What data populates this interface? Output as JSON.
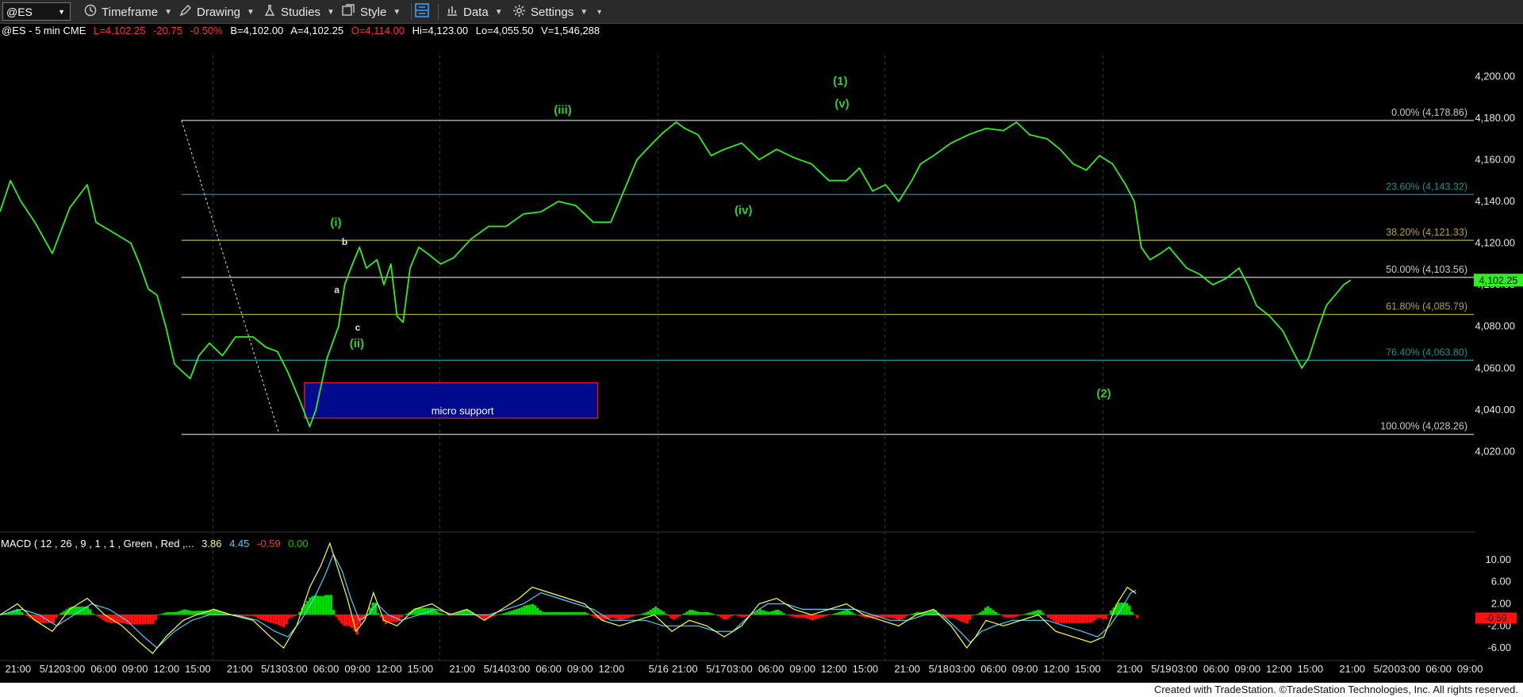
{
  "toolbar": {
    "symbol": "@ES",
    "timeframe": "Timeframe",
    "drawing": "Drawing",
    "studies": "Studies",
    "style": "Style",
    "data": "Data",
    "settings": "Settings"
  },
  "header": {
    "symbol_info": "@ES - 5 min  CME",
    "last": "L=4,102.25",
    "change": "-20.75",
    "pct": "-0.50%",
    "bid": "B=4,102.00",
    "ask": "A=4,102.25",
    "open": "O=4,114.00",
    "high": "Hi=4,123.00",
    "low": "Lo=4,055.50",
    "volume": "V=1,546,288"
  },
  "colors": {
    "price": "#33ee22",
    "up": "#00dd00",
    "down": "#ff1111",
    "macd": "#ffff55",
    "signal": "#4fd0ff",
    "gold": "#b0a33a",
    "teal": "#1a8f8f"
  },
  "macd_label": {
    "text": "MACD ( 12 , 26 , 9 , 1 , 1 , Green , Red ,...",
    "v1": "3.86",
    "v2": "4.45",
    "v3": "-0.59",
    "v4": "0.00"
  },
  "footer": "Created with TradeStation. ©TradeStation Technologies, Inc. All rights reserved.",
  "chart_data": {
    "type": "line",
    "title": "@ES - 5 min",
    "ylim": [
      4000,
      4210
    ],
    "yticks": [
      4020,
      4040,
      4060,
      4080,
      4100,
      4120,
      4140,
      4160,
      4180,
      4200
    ],
    "ytick_labels": [
      "4,020.00",
      "4,040.00",
      "4,060.00",
      "4,080.00",
      "4,100.00",
      "4,120.00",
      "4,140.00",
      "4,160.00",
      "4,180.00",
      "4,200.00"
    ],
    "x_labels": [
      {
        "t": "21:00",
        "bar": 8
      },
      {
        "t": "5/12",
        "bar": 44
      },
      {
        "t": "03:00",
        "bar": 70
      },
      {
        "t": "06:00",
        "bar": 106
      },
      {
        "t": "09:00",
        "bar": 142
      },
      {
        "t": "12:00",
        "bar": 178
      },
      {
        "t": "15:00",
        "bar": 214
      },
      {
        "t": "21:00",
        "bar": 262
      },
      {
        "t": "5/13",
        "bar": 298
      },
      {
        "t": "03:00",
        "bar": 325
      },
      {
        "t": "06:00",
        "bar": 361
      },
      {
        "t": "09:00",
        "bar": 397
      },
      {
        "t": "12:00",
        "bar": 433
      },
      {
        "t": "15:00",
        "bar": 469
      },
      {
        "t": "21:00",
        "bar": 517
      },
      {
        "t": "5/14",
        "bar": 553
      },
      {
        "t": "03:00",
        "bar": 580
      },
      {
        "t": "06:00",
        "bar": 616
      },
      {
        "t": "09:00",
        "bar": 652
      },
      {
        "t": "12:00",
        "bar": 688
      },
      {
        "t": "5/16",
        "bar": 742
      },
      {
        "t": "21:00",
        "bar": 772
      },
      {
        "t": "5/17",
        "bar": 808
      },
      {
        "t": "03:00",
        "bar": 835
      },
      {
        "t": "06:00",
        "bar": 871
      },
      {
        "t": "09:00",
        "bar": 907
      },
      {
        "t": "12:00",
        "bar": 943
      },
      {
        "t": "15:00",
        "bar": 979
      },
      {
        "t": "21:00",
        "bar": 1027
      },
      {
        "t": "5/18",
        "bar": 1063
      },
      {
        "t": "03:00",
        "bar": 1090
      },
      {
        "t": "06:00",
        "bar": 1126
      },
      {
        "t": "09:00",
        "bar": 1162
      },
      {
        "t": "12:00",
        "bar": 1198
      },
      {
        "t": "15:00",
        "bar": 1234
      },
      {
        "t": "21:00",
        "bar": 1282
      },
      {
        "t": "5/19",
        "bar": 1318
      },
      {
        "t": "03:00",
        "bar": 1345
      },
      {
        "t": "06:00",
        "bar": 1381
      },
      {
        "t": "09:00",
        "bar": 1417
      },
      {
        "t": "12:00",
        "bar": 1453
      },
      {
        "t": "15:00",
        "bar": 1489
      },
      {
        "t": "21:00",
        "bar": 1537
      },
      {
        "t": "5/20",
        "bar": 1573
      },
      {
        "t": "03:00",
        "bar": 1600
      },
      {
        "t": "06:00",
        "bar": 1636
      },
      {
        "t": "09:00",
        "bar": 1672
      }
    ],
    "session_bars": [
      244,
      504,
      754,
      1014,
      1264
    ],
    "price_path": [
      [
        0,
        4135
      ],
      [
        12,
        4150
      ],
      [
        24,
        4140
      ],
      [
        40,
        4130
      ],
      [
        60,
        4115
      ],
      [
        80,
        4137
      ],
      [
        100,
        4148
      ],
      [
        110,
        4130
      ],
      [
        130,
        4125
      ],
      [
        150,
        4120
      ],
      [
        160,
        4110
      ],
      [
        170,
        4098
      ],
      [
        180,
        4095
      ],
      [
        190,
        4080
      ],
      [
        200,
        4062
      ],
      [
        210,
        4058
      ],
      [
        218,
        4055
      ],
      [
        228,
        4066
      ],
      [
        240,
        4072
      ],
      [
        255,
        4066
      ],
      [
        270,
        4075
      ],
      [
        290,
        4075
      ],
      [
        305,
        4070
      ],
      [
        318,
        4068
      ],
      [
        330,
        4058
      ],
      [
        345,
        4043
      ],
      [
        355,
        4032
      ],
      [
        362,
        4040
      ],
      [
        375,
        4065
      ],
      [
        388,
        4080
      ],
      [
        395,
        4100
      ],
      [
        404,
        4110
      ],
      [
        412,
        4118
      ],
      [
        420,
        4108
      ],
      [
        432,
        4112
      ],
      [
        440,
        4100
      ],
      [
        448,
        4110
      ],
      [
        455,
        4085
      ],
      [
        462,
        4082
      ],
      [
        470,
        4108
      ],
      [
        480,
        4118
      ],
      [
        490,
        4115
      ],
      [
        505,
        4110
      ],
      [
        520,
        4113
      ],
      [
        540,
        4122
      ],
      [
        560,
        4128
      ],
      [
        580,
        4128
      ],
      [
        600,
        4134
      ],
      [
        620,
        4135
      ],
      [
        640,
        4140
      ],
      [
        660,
        4138
      ],
      [
        680,
        4130
      ],
      [
        700,
        4130
      ],
      [
        715,
        4145
      ],
      [
        730,
        4160
      ],
      [
        748,
        4168
      ],
      [
        760,
        4173
      ],
      [
        775,
        4178
      ],
      [
        785,
        4175
      ],
      [
        800,
        4172
      ],
      [
        815,
        4162
      ],
      [
        830,
        4165
      ],
      [
        850,
        4168
      ],
      [
        870,
        4160
      ],
      [
        890,
        4165
      ],
      [
        910,
        4161
      ],
      [
        930,
        4158
      ],
      [
        950,
        4150
      ],
      [
        970,
        4150
      ],
      [
        985,
        4156
      ],
      [
        1000,
        4145
      ],
      [
        1015,
        4148
      ],
      [
        1030,
        4140
      ],
      [
        1045,
        4150
      ],
      [
        1055,
        4158
      ],
      [
        1070,
        4162
      ],
      [
        1090,
        4168
      ],
      [
        1110,
        4172
      ],
      [
        1130,
        4175
      ],
      [
        1150,
        4174
      ],
      [
        1165,
        4178
      ],
      [
        1180,
        4172
      ],
      [
        1200,
        4170
      ],
      [
        1215,
        4165
      ],
      [
        1230,
        4158
      ],
      [
        1245,
        4155
      ],
      [
        1260,
        4162
      ],
      [
        1275,
        4158
      ],
      [
        1290,
        4148
      ],
      [
        1300,
        4140
      ],
      [
        1308,
        4118
      ],
      [
        1318,
        4112
      ],
      [
        1330,
        4115
      ],
      [
        1340,
        4118
      ],
      [
        1350,
        4113
      ],
      [
        1360,
        4108
      ],
      [
        1375,
        4105
      ],
      [
        1390,
        4100
      ],
      [
        1405,
        4103
      ],
      [
        1420,
        4108
      ],
      [
        1430,
        4100
      ],
      [
        1440,
        4090
      ],
      [
        1455,
        4085
      ],
      [
        1470,
        4078
      ],
      [
        1482,
        4068
      ],
      [
        1492,
        4060
      ],
      [
        1500,
        4065
      ],
      [
        1510,
        4078
      ],
      [
        1520,
        4090
      ],
      [
        1530,
        4095
      ],
      [
        1540,
        4100
      ],
      [
        1548,
        4102.25
      ]
    ],
    "fib_levels": [
      {
        "pct": "0.00%",
        "value": 4178.86,
        "label": "0.00% (4,178.86)",
        "color": "#c8c8c8"
      },
      {
        "pct": "23.60%",
        "value": 4143.32,
        "label": "23.60% (4,143.32)",
        "color": "#1a8f8f"
      },
      {
        "pct": "38.20%",
        "value": 4121.33,
        "label": "38.20% (4,121.33)",
        "color": "#b0a33a"
      },
      {
        "pct": "50.00%",
        "value": 4103.56,
        "label": "50.00% (4,103.56)",
        "color": "#c8c8c8"
      },
      {
        "pct": "61.80%",
        "value": 4085.79,
        "label": "61.80% (4,085.79)",
        "color": "#b0a33a"
      },
      {
        "pct": "76.40%",
        "value": 4063.8,
        "label": "76.40% (4,063.80)",
        "color": "#1a8f8f"
      },
      {
        "pct": "100.00%",
        "value": 4028.26,
        "label": "100.00% (4,028.26)",
        "color": "#c8c8c8"
      }
    ],
    "fib_start_bar": 208,
    "trendline": {
      "from": [
        208,
        4178.86
      ],
      "to": [
        320,
        4028.26
      ]
    },
    "support_zone": {
      "label": "micro support",
      "bar_from": 349,
      "bar_to": 685,
      "y_from": 4036,
      "y_to": 4053
    },
    "wave_labels": [
      {
        "text": "(i)",
        "bar": 385,
        "value": 4128,
        "color": "#33cc33"
      },
      {
        "text": "a",
        "bar": 386,
        "value": 4096,
        "color": "#e0e0e0"
      },
      {
        "text": "b",
        "bar": 395,
        "value": 4119,
        "color": "#e0e0e0"
      },
      {
        "text": "c",
        "bar": 410,
        "value": 4078,
        "color": "#e0e0e0"
      },
      {
        "text": "(ii)",
        "bar": 409,
        "value": 4070,
        "color": "#33cc33"
      },
      {
        "text": "(iii)",
        "bar": 645,
        "value": 4182,
        "color": "#33cc33"
      },
      {
        "text": "(iv)",
        "bar": 852,
        "value": 4134,
        "color": "#33cc33"
      },
      {
        "text": "(1)",
        "bar": 963,
        "value": 4196,
        "color": "#33cc33"
      },
      {
        "text": "(v)",
        "bar": 965,
        "value": 4185,
        "color": "#33cc33"
      },
      {
        "text": "(2)",
        "bar": 1265,
        "value": 4046,
        "color": "#33cc33"
      }
    ],
    "last_price": 4102.25,
    "last_price_label": "4,102.25",
    "macd": {
      "ylim": [
        -8,
        14
      ],
      "ticks": [
        10,
        6,
        2,
        -2,
        -6
      ],
      "tick_labels": [
        "10.00",
        "6.00",
        "2.00",
        "-2.00",
        "-6.00"
      ],
      "current_label": "-0.59",
      "current_value": -0.59,
      "macd_path": [
        [
          0,
          0
        ],
        [
          20,
          2
        ],
        [
          40,
          -1
        ],
        [
          60,
          -3
        ],
        [
          80,
          1
        ],
        [
          100,
          3
        ],
        [
          120,
          0
        ],
        [
          140,
          -2
        ],
        [
          160,
          -5
        ],
        [
          175,
          -7
        ],
        [
          190,
          -4
        ],
        [
          210,
          -1
        ],
        [
          225,
          0
        ],
        [
          245,
          1
        ],
        [
          265,
          0
        ],
        [
          290,
          -1
        ],
        [
          310,
          -4
        ],
        [
          325,
          -6
        ],
        [
          340,
          -2
        ],
        [
          355,
          5
        ],
        [
          368,
          9
        ],
        [
          378,
          13
        ],
        [
          388,
          8
        ],
        [
          398,
          3
        ],
        [
          408,
          -3
        ],
        [
          418,
          -1
        ],
        [
          428,
          4
        ],
        [
          440,
          -1
        ],
        [
          455,
          -2
        ],
        [
          475,
          1
        ],
        [
          495,
          2
        ],
        [
          515,
          0
        ],
        [
          535,
          1
        ],
        [
          555,
          -1
        ],
        [
          575,
          1
        ],
        [
          595,
          3
        ],
        [
          610,
          5
        ],
        [
          630,
          4
        ],
        [
          650,
          3
        ],
        [
          670,
          2
        ],
        [
          690,
          -1
        ],
        [
          710,
          -2
        ],
        [
          730,
          -1
        ],
        [
          750,
          0
        ],
        [
          770,
          -3
        ],
        [
          790,
          -1
        ],
        [
          810,
          -2
        ],
        [
          830,
          -4
        ],
        [
          850,
          -2
        ],
        [
          870,
          2
        ],
        [
          890,
          3
        ],
        [
          910,
          1
        ],
        [
          930,
          0
        ],
        [
          950,
          1
        ],
        [
          970,
          2
        ],
        [
          990,
          0
        ],
        [
          1010,
          -1
        ],
        [
          1030,
          -2
        ],
        [
          1050,
          0
        ],
        [
          1070,
          1
        ],
        [
          1090,
          -2
        ],
        [
          1108,
          -6
        ],
        [
          1118,
          -4
        ],
        [
          1130,
          -1
        ],
        [
          1150,
          -2
        ],
        [
          1170,
          -1
        ],
        [
          1190,
          0
        ],
        [
          1210,
          -3
        ],
        [
          1230,
          -4
        ],
        [
          1250,
          -5
        ],
        [
          1265,
          -4
        ],
        [
          1280,
          2
        ],
        [
          1292,
          5
        ],
        [
          1302,
          3.86
        ]
      ],
      "signal_path": [
        [
          0,
          0
        ],
        [
          25,
          1
        ],
        [
          45,
          0
        ],
        [
          65,
          -2
        ],
        [
          85,
          0
        ],
        [
          105,
          2
        ],
        [
          125,
          1
        ],
        [
          145,
          -1
        ],
        [
          165,
          -4
        ],
        [
          180,
          -6
        ],
        [
          200,
          -3
        ],
        [
          220,
          -1
        ],
        [
          240,
          0
        ],
        [
          270,
          0
        ],
        [
          295,
          -1
        ],
        [
          315,
          -3
        ],
        [
          330,
          -4
        ],
        [
          345,
          -1
        ],
        [
          360,
          3
        ],
        [
          372,
          7
        ],
        [
          382,
          11
        ],
        [
          392,
          8
        ],
        [
          402,
          3
        ],
        [
          412,
          -1
        ],
        [
          422,
          0
        ],
        [
          432,
          2
        ],
        [
          445,
          0
        ],
        [
          460,
          -1
        ],
        [
          480,
          0
        ],
        [
          500,
          1
        ],
        [
          520,
          0
        ],
        [
          540,
          0
        ],
        [
          560,
          0
        ],
        [
          580,
          1
        ],
        [
          600,
          2
        ],
        [
          620,
          4
        ],
        [
          640,
          3
        ],
        [
          660,
          2
        ],
        [
          680,
          1
        ],
        [
          700,
          -1
        ],
        [
          720,
          -1
        ],
        [
          740,
          -1
        ],
        [
          760,
          -2
        ],
        [
          780,
          -2
        ],
        [
          800,
          -2
        ],
        [
          820,
          -3
        ],
        [
          840,
          -3
        ],
        [
          860,
          0
        ],
        [
          880,
          2
        ],
        [
          900,
          2
        ],
        [
          920,
          1
        ],
        [
          940,
          1
        ],
        [
          960,
          1
        ],
        [
          980,
          1
        ],
        [
          1000,
          0
        ],
        [
          1020,
          -1
        ],
        [
          1040,
          -1
        ],
        [
          1060,
          0
        ],
        [
          1080,
          0
        ],
        [
          1100,
          -3
        ],
        [
          1112,
          -5
        ],
        [
          1125,
          -3
        ],
        [
          1140,
          -2
        ],
        [
          1160,
          -1
        ],
        [
          1180,
          -1
        ],
        [
          1200,
          -1
        ],
        [
          1220,
          -2
        ],
        [
          1240,
          -3
        ],
        [
          1258,
          -4
        ],
        [
          1272,
          -2
        ],
        [
          1285,
          1
        ],
        [
          1296,
          4
        ],
        [
          1302,
          4.45
        ]
      ]
    }
  }
}
